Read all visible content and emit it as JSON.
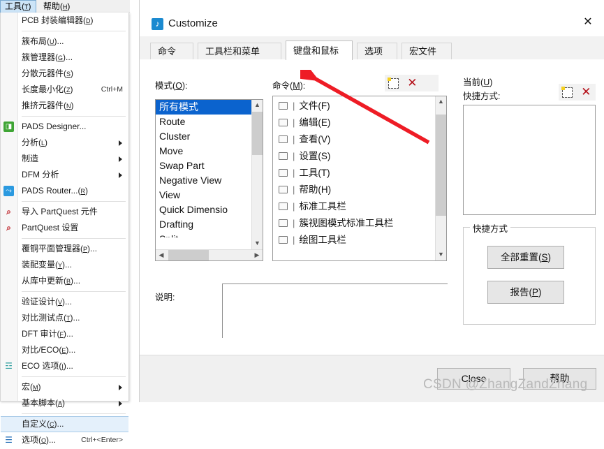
{
  "menubar": {
    "items": [
      {
        "label": "工具",
        "mnemonic": "T",
        "active": true
      },
      {
        "label": "帮助",
        "mnemonic": "H",
        "active": false
      }
    ]
  },
  "dropdown_menu": {
    "items": [
      {
        "type": "item",
        "label": "PCB 封装编辑器",
        "mnemonic": "D",
        "suffix": "",
        "accel": "",
        "icon": "",
        "submenu": false,
        "selected": false
      },
      {
        "type": "separator"
      },
      {
        "type": "item",
        "label": "簇布局",
        "mnemonic": "U",
        "suffix": "...",
        "accel": "",
        "icon": "",
        "submenu": false,
        "selected": false
      },
      {
        "type": "item",
        "label": "簇管理器",
        "mnemonic": "G",
        "suffix": "...",
        "accel": "",
        "icon": "",
        "submenu": false,
        "selected": false
      },
      {
        "type": "item",
        "label": "分散元器件",
        "mnemonic": "S",
        "suffix": "",
        "accel": "",
        "icon": "",
        "submenu": false,
        "selected": false
      },
      {
        "type": "item",
        "label": "长度最小化",
        "mnemonic": "Z",
        "suffix": "",
        "accel": "Ctrl+M",
        "icon": "",
        "submenu": false,
        "selected": false
      },
      {
        "type": "item",
        "label": "推挤元器件",
        "mnemonic": "N",
        "suffix": "",
        "accel": "",
        "icon": "",
        "submenu": false,
        "selected": false
      },
      {
        "type": "separator"
      },
      {
        "type": "item",
        "label": "PADS Designer...",
        "mnemonic": "",
        "suffix": "",
        "accel": "",
        "icon": "pads-designer-icon",
        "submenu": false,
        "selected": false
      },
      {
        "type": "item",
        "label": "分析",
        "mnemonic": "L",
        "suffix": "",
        "accel": "",
        "icon": "",
        "submenu": true,
        "selected": false
      },
      {
        "type": "item",
        "label": "制造",
        "mnemonic": "",
        "suffix": "",
        "accel": "",
        "icon": "",
        "submenu": true,
        "selected": false
      },
      {
        "type": "item",
        "label": "DFM 分析",
        "mnemonic": "",
        "suffix": "",
        "accel": "",
        "icon": "",
        "submenu": true,
        "selected": false
      },
      {
        "type": "item",
        "label": "PADS Router...",
        "mnemonic": "R",
        "suffix": "",
        "accel": "",
        "icon": "pads-router-icon",
        "submenu": false,
        "selected": false
      },
      {
        "type": "separator"
      },
      {
        "type": "item",
        "label": "导入 PartQuest 元件",
        "mnemonic": "",
        "suffix": "",
        "accel": "",
        "icon": "partquest-import-icon",
        "submenu": false,
        "selected": false
      },
      {
        "type": "item",
        "label": "PartQuest 设置",
        "mnemonic": "",
        "suffix": "",
        "accel": "",
        "icon": "partquest-settings-icon",
        "submenu": false,
        "selected": false
      },
      {
        "type": "separator"
      },
      {
        "type": "item",
        "label": "覆铜平面管理器",
        "mnemonic": "P",
        "suffix": "...",
        "accel": "",
        "icon": "",
        "submenu": false,
        "selected": false
      },
      {
        "type": "item",
        "label": "装配变量",
        "mnemonic": "Y",
        "suffix": "...",
        "accel": "",
        "icon": "",
        "submenu": false,
        "selected": false
      },
      {
        "type": "item",
        "label": "从库中更新",
        "mnemonic": "B",
        "suffix": "...",
        "accel": "",
        "icon": "",
        "submenu": false,
        "selected": false
      },
      {
        "type": "separator"
      },
      {
        "type": "item",
        "label": "验证设计",
        "mnemonic": "V",
        "suffix": "...",
        "accel": "",
        "icon": "",
        "submenu": false,
        "selected": false
      },
      {
        "type": "item",
        "label": "对比测试点",
        "mnemonic": "T",
        "suffix": "...",
        "accel": "",
        "icon": "",
        "submenu": false,
        "selected": false
      },
      {
        "type": "item",
        "label": "DFT 审计",
        "mnemonic": "F",
        "suffix": "...",
        "accel": "",
        "icon": "",
        "submenu": false,
        "selected": false
      },
      {
        "type": "item",
        "label": "对比/ECO",
        "mnemonic": "E",
        "suffix": "...",
        "accel": "",
        "icon": "",
        "submenu": false,
        "selected": false
      },
      {
        "type": "item",
        "label": "ECO 选项",
        "mnemonic": "I",
        "suffix": "...",
        "accel": "",
        "icon": "eco-options-icon",
        "submenu": false,
        "selected": false
      },
      {
        "type": "separator"
      },
      {
        "type": "item",
        "label": "宏",
        "mnemonic": "M",
        "suffix": "",
        "accel": "",
        "icon": "",
        "submenu": true,
        "selected": false
      },
      {
        "type": "item",
        "label": "基本脚本",
        "mnemonic": "A",
        "suffix": "",
        "accel": "",
        "icon": "",
        "submenu": true,
        "selected": false
      },
      {
        "type": "separator"
      },
      {
        "type": "item",
        "label": "自定义",
        "mnemonic": "C",
        "suffix": "...",
        "accel": "",
        "icon": "",
        "submenu": false,
        "selected": true
      },
      {
        "type": "item",
        "label": "选项",
        "mnemonic": "O",
        "suffix": "...",
        "accel": "Ctrl+<Enter>",
        "icon": "options-icon",
        "submenu": false,
        "selected": false
      }
    ]
  },
  "dialog": {
    "title": "Customize",
    "icon": "customize-icon",
    "close_label": "✕",
    "tabs": [
      {
        "label": "命令",
        "active": false
      },
      {
        "label": "工具栏和菜单",
        "active": false
      },
      {
        "label": "键盘和鼠标",
        "active": true
      },
      {
        "label": "选项",
        "active": false
      },
      {
        "label": "宏文件",
        "active": false
      }
    ],
    "mode_section": {
      "label": "模式",
      "mnemonic": "O",
      "items": [
        {
          "text": "所有模式",
          "selected": true
        },
        {
          "text": "Route",
          "selected": false
        },
        {
          "text": "Cluster",
          "selected": false
        },
        {
          "text": "Move",
          "selected": false
        },
        {
          "text": "Swap Part",
          "selected": false
        },
        {
          "text": "Negative View",
          "selected": false
        },
        {
          "text": "View",
          "selected": false
        },
        {
          "text": "Quick Dimensio",
          "selected": false
        },
        {
          "text": "Drafting",
          "selected": false
        }
      ]
    },
    "command_section": {
      "label": "命令",
      "mnemonic": "M",
      "toolbar": [
        {
          "name": "new-icon",
          "glyph": "new"
        },
        {
          "name": "delete-icon",
          "glyph": "x"
        },
        {
          "name": "edit-icon",
          "glyph": "pen"
        }
      ],
      "items": [
        "文件(F)",
        "编辑(E)",
        "查看(V)",
        "设置(S)",
        "工具(T)",
        "帮助(H)",
        "标准工具栏",
        "簇视图模式标准工具栏",
        "绘图工具栏"
      ]
    },
    "current_section": {
      "label_line1": "当前",
      "mnemonic": "U",
      "label_line2": "快捷方式:",
      "toolbar": [
        {
          "name": "new-icon",
          "glyph": "new"
        },
        {
          "name": "delete-icon",
          "glyph": "x"
        }
      ],
      "list_items": []
    },
    "shortcut_group": {
      "title": "快捷方式",
      "buttons": [
        {
          "label": "全部重置",
          "mnemonic": "S"
        },
        {
          "label": "报告",
          "mnemonic": "P"
        }
      ]
    },
    "description": {
      "label": "说明:",
      "value": ""
    },
    "footer_buttons": [
      {
        "label": "Close",
        "mnemonic": ""
      },
      {
        "label": "帮助",
        "mnemonic": ""
      }
    ]
  },
  "annotation": {
    "arrow_color": "#ee1c25",
    "watermark": "CSDN @ZhangZandZhang"
  }
}
